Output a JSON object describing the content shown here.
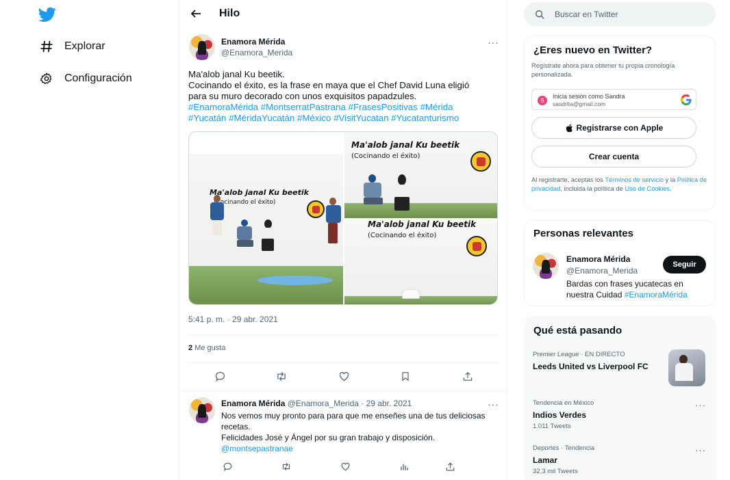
{
  "nav": {
    "items": [
      {
        "label": "Explorar",
        "icon": "hash-icon"
      },
      {
        "label": "Configuración",
        "icon": "gear-icon"
      }
    ]
  },
  "thread": {
    "title": "Hilo",
    "tweet": {
      "author_name": "Enamora Mérida",
      "author_handle": "@Enamora_Merida",
      "text_lines": [
        "Ma'alob janal Ku beetik.",
        "Cocinando el éxito, es la frase en maya que el Chef David Luna eligió",
        "para su muro decorado con unos exquisitos papadzules."
      ],
      "hashtags_line1": "#EnamoraMérida #MontserratPastrana #FrasesPositivas #Mérida",
      "hashtags_line2": "#Yucatán #MéridaYucatán #México #VisitYucatan #Yucatanturismo",
      "mural_text": "Ma'alob janal Ku beetik",
      "mural_subtext": "(Cocinando el éxito)",
      "timestamp": "5:41 p. m. · 29 abr. 2021",
      "likes_count": "2",
      "likes_label": "Me gusta",
      "more": "···"
    },
    "reply": {
      "author_name": "Enamora Mérida",
      "author_handle": "@Enamora_Merida",
      "date": "· 29 abr. 2021",
      "line1": "Nos vemos muy pronto para para que me enseñes una de tus deliciosas",
      "line2": "recetas.",
      "line3": "Felicidades José y Ángel por su gran trabajo y disposición.",
      "mention": "@montsepastranae",
      "more": "···"
    }
  },
  "search": {
    "placeholder": "Buscar en Twitter"
  },
  "signup": {
    "title": "¿Eres nuevo en Twitter?",
    "subtitle_line1": "Regístrate ahora para obtener tu propia cronología",
    "subtitle_line2": "personalizada.",
    "google_line1": "Inicia sesión como Sandra",
    "google_line2": "sasdrita@gmail.com",
    "google_initial": "S",
    "apple_label": "Registrarse con Apple",
    "create_label": "Crear cuenta",
    "legal_1": "Al registrarte, aceptas los ",
    "legal_terms": "Términos de servicio",
    "legal_2": " y la ",
    "legal_privacy": "Política de privacidad",
    "legal_3": ", incluida la política de ",
    "legal_cookies": "Uso de Cookies",
    "legal_4": "."
  },
  "relevant": {
    "title": "Personas relevantes",
    "name": "Enamora Mérida",
    "handle": "@Enamora_Merida",
    "follow_label": "Seguir",
    "bio_line1": "Bardas con frases yucatecas en",
    "bio_line2": "nuestra Cuidad ",
    "bio_tag": "#EnamoraMérida"
  },
  "trends": {
    "title": "Qué está pasando",
    "items": [
      {
        "meta": "Premier League · EN DIRECTO",
        "name": "Leeds United vs Liverpool FC",
        "count": ""
      },
      {
        "meta": "Tendencia en México",
        "name": "Indios Verdes",
        "count": "1.011 Tweets",
        "more": "···"
      },
      {
        "meta": "Deportes · Tendencia",
        "name": "Lamar",
        "count": "32,3 mil Tweets",
        "more": "···"
      }
    ]
  },
  "colors": {
    "accent": "#1d9bf0",
    "text": "#0f1419",
    "muted": "#536471"
  }
}
